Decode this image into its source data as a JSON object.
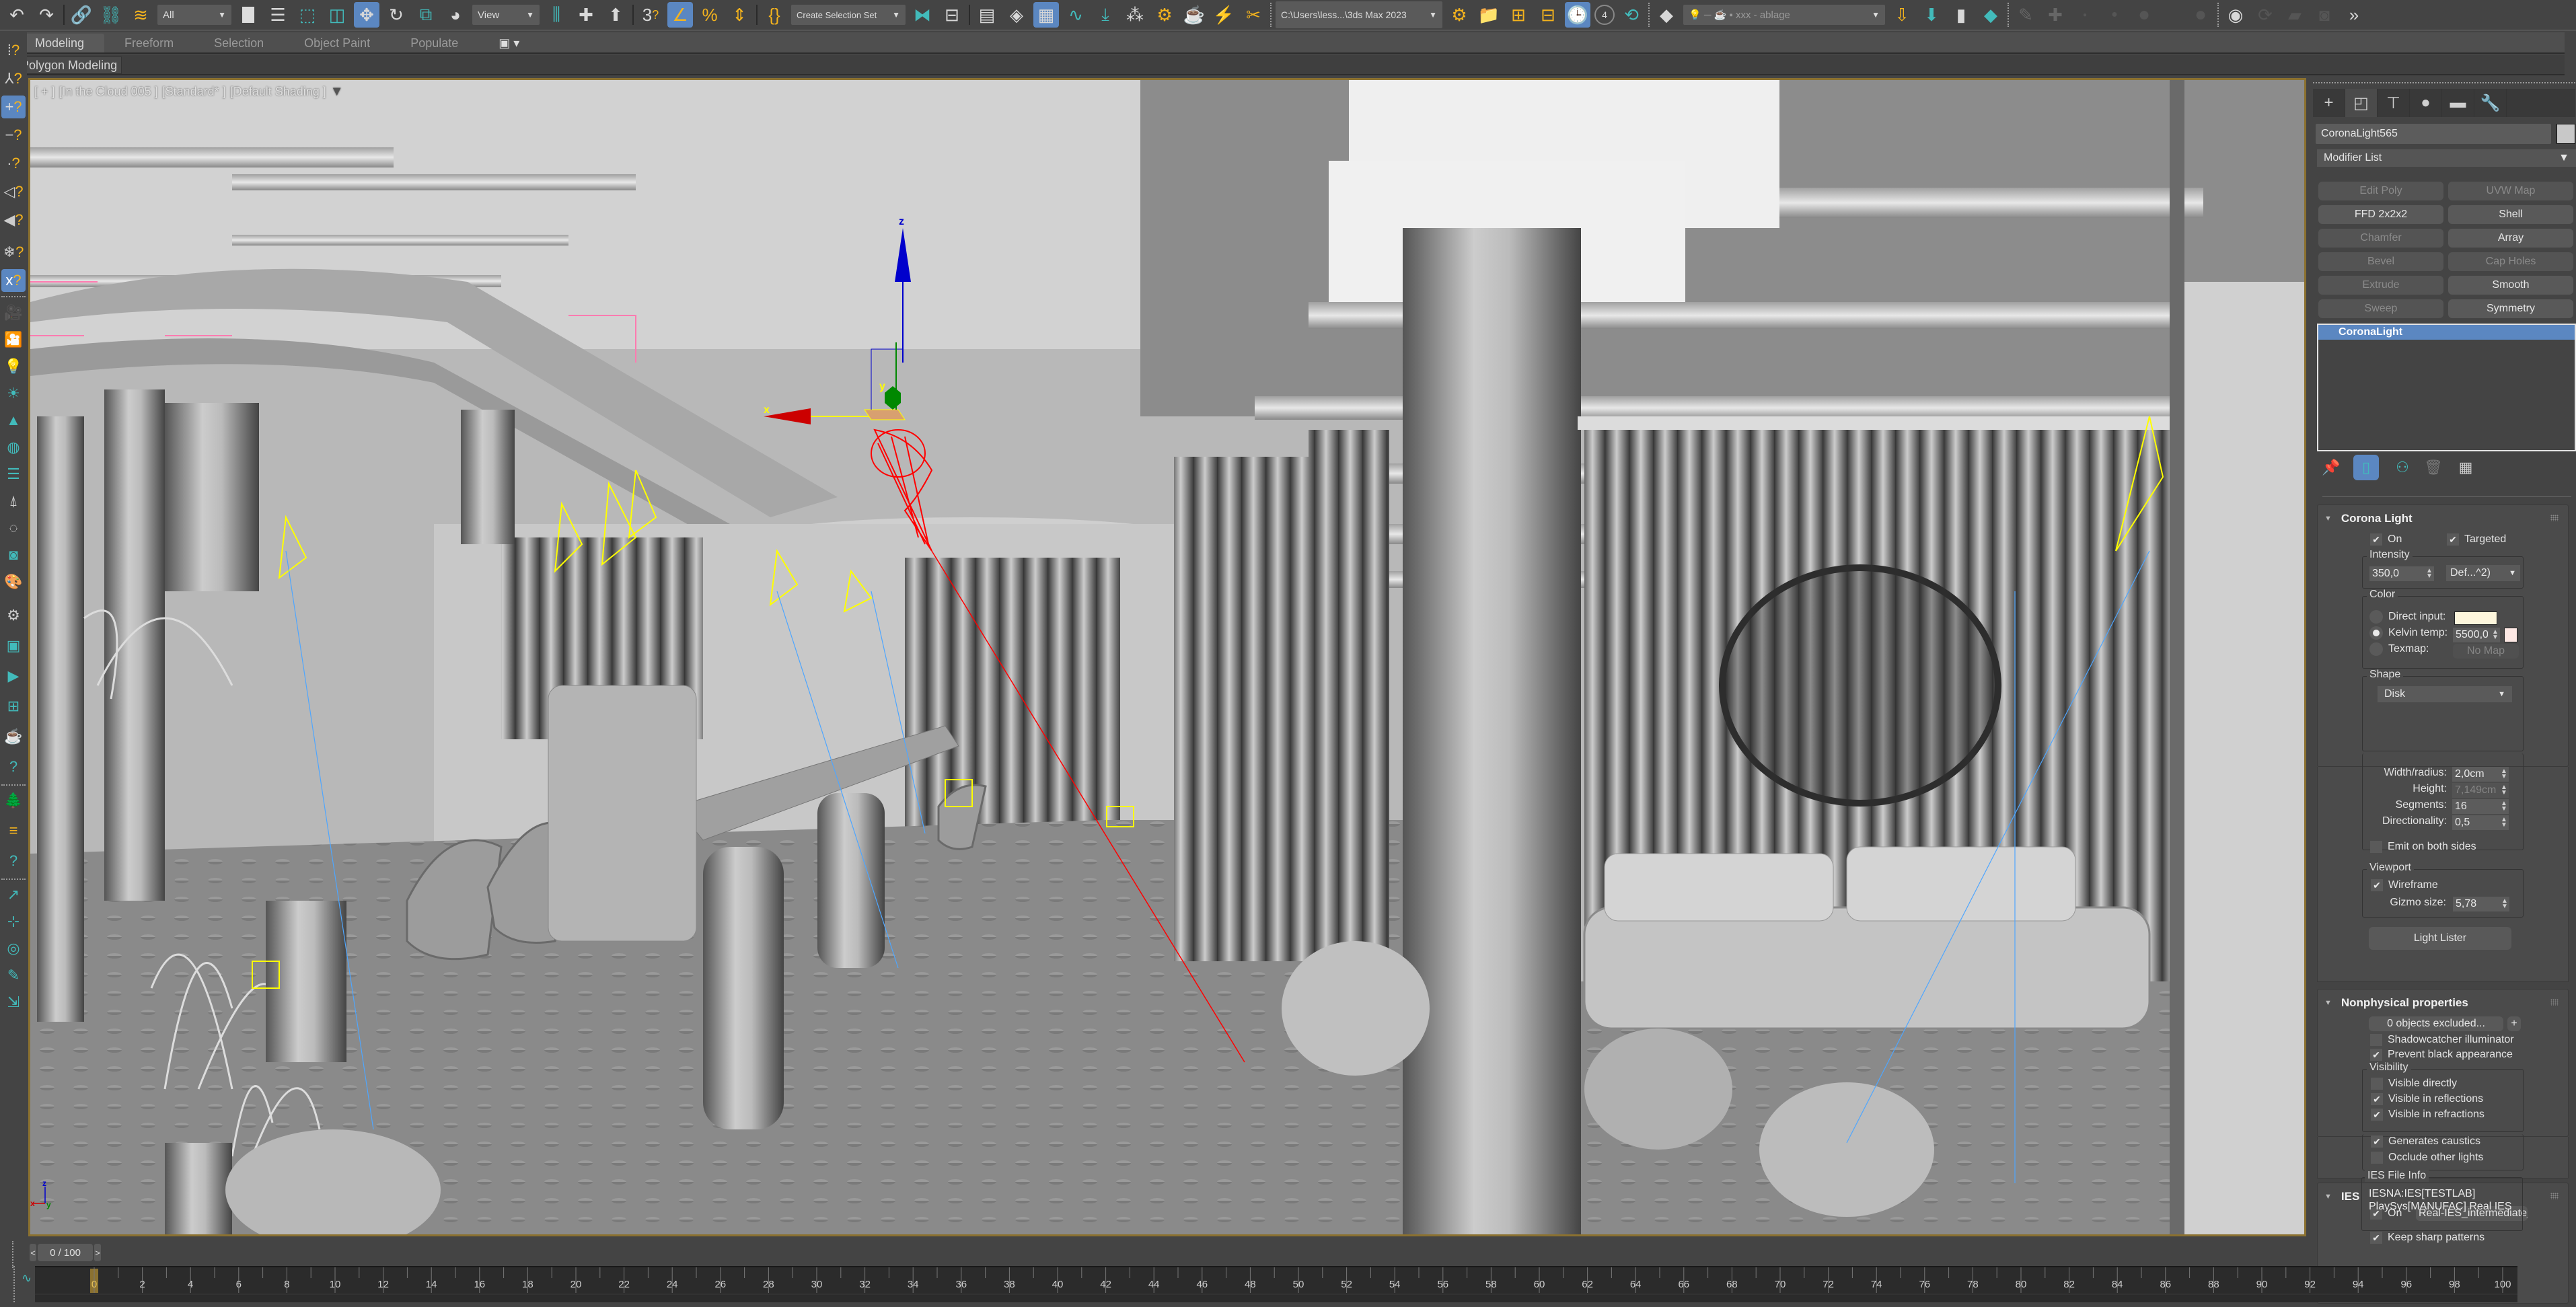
{
  "app": {
    "name": "3ds Max 2023"
  },
  "main_toolbar": {
    "selection_filter": "All",
    "reference_coord": "View",
    "named_selection_set": "Create Selection Set",
    "project_path": "C:\\Users\\less...\\3ds Max 2023",
    "scene_explorer_layer": "xxx - ablage",
    "angle_snap_digit": "3",
    "snap_counter": "4",
    "icons": [
      "undo-icon",
      "redo-icon",
      "select-and-link-icon",
      "unlink-icon",
      "bind-space-warp-icon",
      "select-object-icon",
      "select-by-name-icon",
      "rect-selection-region-icon",
      "window-crossing-icon",
      "select-and-move-icon",
      "select-and-rotate-icon",
      "select-and-scale-icon",
      "select-and-place-icon",
      "use-pivot-icon",
      "select-manipulate-icon",
      "keyboard-shortcut-override-icon",
      "snaps-toggle-icon",
      "angle-snap-icon",
      "percent-snap-icon",
      "spinner-snap-icon",
      "edit-named-selection-icon",
      "mirror-icon",
      "align-icon",
      "toggle-scene-explorer-icon",
      "toggle-layer-explorer-icon",
      "toggle-ribbon-icon",
      "curve-editor-icon",
      "schematic-view-icon",
      "material-editor-icon",
      "render-setup-icon",
      "rendered-frame-window-icon",
      "render-production-icon",
      "cut-icon"
    ]
  },
  "ribbon": {
    "tabs": [
      {
        "label": "Modeling",
        "active": true
      },
      {
        "label": "Freeform",
        "active": false
      },
      {
        "label": "Selection",
        "active": false
      },
      {
        "label": "Object Paint",
        "active": false
      },
      {
        "label": "Populate",
        "active": false
      }
    ],
    "panel_label": "Polygon Modeling"
  },
  "viewport": {
    "label_parts": [
      "[ + ]",
      "[In the Cloud 005 ]",
      "[Standard* ]",
      "[Default Shading ]"
    ],
    "gizmo_axes": {
      "x": "x",
      "y": "y",
      "z": "z"
    },
    "axis_tripod": {
      "x": "x",
      "y": "y",
      "z": "z"
    },
    "colors": {
      "frame": "#8b7130",
      "selected_light": "#ff0000",
      "lights": "#ffff00",
      "target_line": "#4ea6ff"
    }
  },
  "command_panel": {
    "tabs": [
      "create",
      "modify",
      "hierarchy",
      "motion",
      "display",
      "utilities"
    ],
    "active_tab": "modify",
    "object_name": "CoronaLight565",
    "object_color": "#c8c8c8",
    "modifier_list": "Modifier List",
    "modifier_buttons": [
      {
        "label": "Edit Poly",
        "enabled": false
      },
      {
        "label": "UVW Map",
        "enabled": false
      },
      {
        "label": "FFD 2x2x2",
        "enabled": true
      },
      {
        "label": "Shell",
        "enabled": true
      },
      {
        "label": "Chamfer",
        "enabled": false
      },
      {
        "label": "Array",
        "enabled": true
      },
      {
        "label": "Bevel",
        "enabled": false
      },
      {
        "label": "Cap Holes",
        "enabled": false
      },
      {
        "label": "Extrude",
        "enabled": false
      },
      {
        "label": "Smooth",
        "enabled": true
      },
      {
        "label": "Sweep",
        "enabled": false
      },
      {
        "label": "Symmetry",
        "enabled": true
      }
    ],
    "stack": [
      "CoronaLight"
    ],
    "stack_tools": [
      "pin-stack-icon",
      "show-end-result-icon",
      "make-unique-icon",
      "remove-modifier-icon",
      "configure-modifier-sets-icon"
    ]
  },
  "corona_light": {
    "title": "Corona Light",
    "on": {
      "label": "On",
      "checked": true
    },
    "targeted": {
      "label": "Targeted",
      "checked": true
    },
    "intensity": {
      "label": "Intensity",
      "value": "350,0",
      "unit": "Def...^2)"
    },
    "color": {
      "label": "Color",
      "direct_input": {
        "label": "Direct input:",
        "selected": false,
        "swatch": "#fdf6dc"
      },
      "kelvin": {
        "label": "Kelvin temp:",
        "selected": true,
        "value": "5500,0",
        "swatch": "#fde8e4"
      },
      "texmap": {
        "label": "Texmap:",
        "selected": false,
        "value": "No Map"
      }
    },
    "shape": {
      "label": "Shape",
      "type": "Disk",
      "width_radius": {
        "label": "Width/radius:",
        "value": "2,0cm"
      },
      "height": {
        "label": "Height:",
        "value": "7,149cm"
      },
      "segments": {
        "label": "Segments:",
        "value": "16"
      },
      "directionality": {
        "label": "Directionality:",
        "value": "0,5"
      },
      "emit_both_sides": {
        "label": "Emit on both sides",
        "checked": false
      }
    },
    "viewport": {
      "label": "Viewport",
      "wireframe": {
        "label": "Wireframe",
        "checked": true
      },
      "gizmo_size": {
        "label": "Gizmo size:",
        "value": "5,78"
      }
    },
    "light_lister": "Light Lister"
  },
  "nonphysical": {
    "title": "Nonphysical properties",
    "excluded": "0 objects excluded...",
    "add": "+",
    "shadowcatcher": {
      "label": "Shadowcatcher illuminator",
      "checked": false
    },
    "prevent_black": {
      "label": "Prevent black appearance",
      "checked": true
    },
    "visibility": {
      "label": "Visibility",
      "items": [
        {
          "label": "Visible directly",
          "checked": false
        },
        {
          "label": "Visible in reflections",
          "checked": true
        },
        {
          "label": "Visible in refractions",
          "checked": true
        },
        {
          "label": "Generates caustics",
          "checked": true
        },
        {
          "label": "Occlude other lights",
          "checked": false
        }
      ]
    }
  },
  "ies": {
    "title": "IES",
    "on": {
      "label": "On",
      "checked": true,
      "file": "Real-IES_intermediate_"
    },
    "keep_sharp": {
      "label": "Keep sharp patterns",
      "checked": true
    },
    "file_info": {
      "label": "IES File Info",
      "lines": [
        "IESNA:IES[TESTLAB]",
        "PlaySys[MANUFAC] Real IES"
      ]
    }
  },
  "timeline": {
    "frame_display": "0 / 100",
    "prev": "<",
    "next": ">",
    "current_frame": 0,
    "start": 0,
    "end": 100,
    "tick_labels": [
      0,
      2,
      4,
      6,
      8,
      10,
      12,
      14,
      16,
      18,
      20,
      22,
      24,
      26,
      28,
      30,
      32,
      34,
      36,
      38,
      40,
      42,
      44,
      46,
      48,
      50,
      52,
      54,
      56,
      58,
      60,
      62,
      64,
      66,
      68,
      70,
      72,
      74,
      76,
      78,
      80,
      82,
      84,
      86,
      88,
      90,
      92,
      94,
      96,
      98,
      100
    ]
  },
  "left_toolbar": {
    "icons": [
      "snap-grid-icon",
      "snap-pivot-icon",
      "snap-vertex-icon",
      "snap-endpoint-icon",
      "snap-midpoint-icon",
      "snap-edge-icon",
      "snap-face-icon",
      "snap-frozen-icon",
      "snap-axis-constraint-icon",
      "camera-icon",
      "add-camera-icon",
      "light-icon",
      "sun-icon",
      "scatter-icon",
      "material-icon",
      "render-list-icon",
      "forest-icon",
      "fire-icon",
      "frame-buffer-icon",
      "palette-icon",
      "light-gear-icon",
      "vfb-icon",
      "render-region-icon",
      "interactive-render-icon",
      "teapot-render-icon",
      "help-icon",
      "forest-pack-icon",
      "railclone-icon",
      "help-icon-2",
      "align-icon",
      "center-icon",
      "instance-icon",
      "paint-icon",
      "distribute-icon"
    ]
  }
}
